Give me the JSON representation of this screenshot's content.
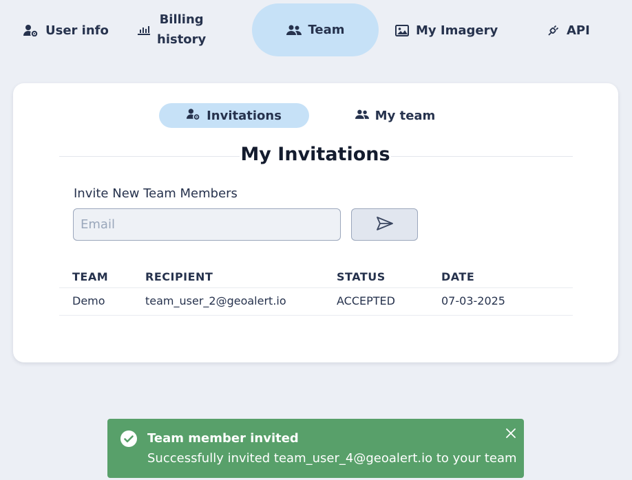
{
  "nav": {
    "items": [
      {
        "label": "User info",
        "icon": "user-gear-icon"
      },
      {
        "label": "Billing\nhistory",
        "icon": "bar-chart-icon"
      },
      {
        "label": "Team",
        "icon": "users-icon",
        "active": true
      },
      {
        "label": "My Imagery",
        "icon": "image-icon"
      },
      {
        "label": "API",
        "icon": "plug-icon"
      }
    ]
  },
  "subtabs": [
    {
      "label": "Invitations",
      "icon": "user-gear-icon",
      "active": true
    },
    {
      "label": "My team",
      "icon": "users-icon"
    }
  ],
  "section": {
    "title": "My Invitations",
    "invite_label": "Invite New Team Members",
    "email_placeholder": "Email",
    "email_value": ""
  },
  "table": {
    "headers": [
      "TEAM",
      "RECIPIENT",
      "STATUS",
      "DATE"
    ],
    "rows": [
      [
        "Demo",
        "team_user_2@geoalert.io",
        "ACCEPTED",
        "07-03-2025"
      ]
    ]
  },
  "toast": {
    "title": "Team member invited",
    "message": "Successfully invited team_user_4@geoalert.io to your team"
  },
  "colors": {
    "background": "#eceff5",
    "active_pill": "#c6e1f7",
    "toast_success": "#58a06a",
    "text": "#26324d"
  }
}
